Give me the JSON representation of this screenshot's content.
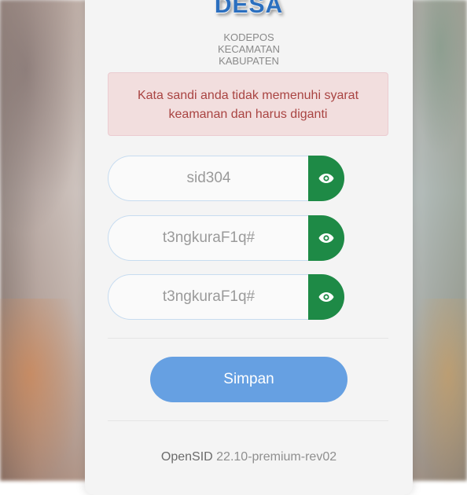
{
  "header": {
    "title": "DESA",
    "lines": [
      "KODEPOS",
      "KECAMATAN",
      "KABUPATEN"
    ]
  },
  "alert": {
    "text": "Kata sandi anda tidak memenuhi syarat keamanan dan harus diganti"
  },
  "form": {
    "fields": [
      {
        "value": "sid304",
        "icon": "eye-icon"
      },
      {
        "value": "t3ngkuraF1q#",
        "icon": "eye-icon"
      },
      {
        "value": "t3ngkuraF1q#",
        "icon": "eye-icon"
      }
    ],
    "submit_label": "Simpan"
  },
  "footer": {
    "app_name": "OpenSID",
    "version": "22.10-premium-rev02"
  },
  "colors": {
    "accent_green": "#1e8a46",
    "button_blue": "#66a0e2",
    "alert_bg": "#f2dede",
    "alert_text": "#a94442"
  }
}
